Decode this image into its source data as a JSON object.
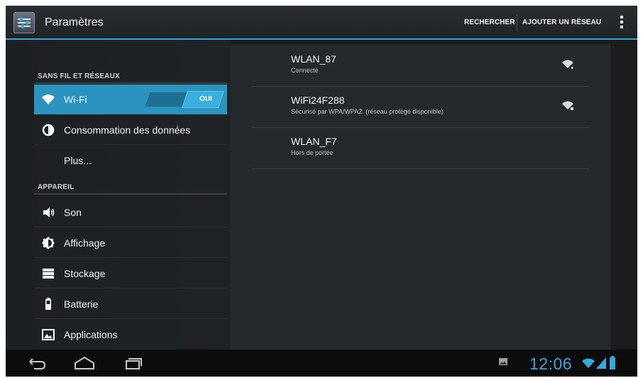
{
  "action_bar": {
    "title": "Paramètres",
    "app_icon": "settings-sliders-icon",
    "actions": [
      {
        "label": "RECHERCHER"
      },
      {
        "label": "AJOUTER UN RÉSEAU"
      }
    ],
    "overflow_icon": "overflow-menu-icon",
    "accent_color": "#2ea7d8"
  },
  "sidebar": {
    "sections": [
      {
        "header": "SANS FIL ET RÉSEAUX"
      },
      {
        "header": "APPAREIL"
      }
    ],
    "items": [
      {
        "label": "Wi-Fi",
        "icon": "wifi-icon",
        "selected": true,
        "toggle": "OUI"
      },
      {
        "label": "Consommation des données",
        "icon": "data-usage-icon"
      },
      {
        "label": "Plus...",
        "icon": ""
      },
      {
        "label": "Son",
        "icon": "sound-icon"
      },
      {
        "label": "Affichage",
        "icon": "brightness-icon"
      },
      {
        "label": "Stockage",
        "icon": "storage-icon"
      },
      {
        "label": "Batterie",
        "icon": "battery-icon"
      },
      {
        "label": "Applications",
        "icon": "applications-icon"
      }
    ],
    "selected_color": "#2a93bf"
  },
  "networks": [
    {
      "name": "WLAN_87",
      "status": "Connecté",
      "signal_icon": "wifi-signal-icon"
    },
    {
      "name": "WiFi24F288",
      "status": "Sécurisé par WPA/WPA2. (réseau protégé disponible)",
      "signal_icon": "wifi-lock-signal-icon"
    },
    {
      "name": "WLAN_F7",
      "status": "Hors de portée",
      "signal_icon": ""
    }
  ],
  "nav_bar": {
    "buttons": [
      "back-icon",
      "home-icon",
      "recent-apps-icon"
    ],
    "clock": "12:06",
    "status_icons": [
      "gallery-notification-icon",
      "wifi-status-icon",
      "cell-signal-icon",
      "battery-status-icon"
    ]
  }
}
